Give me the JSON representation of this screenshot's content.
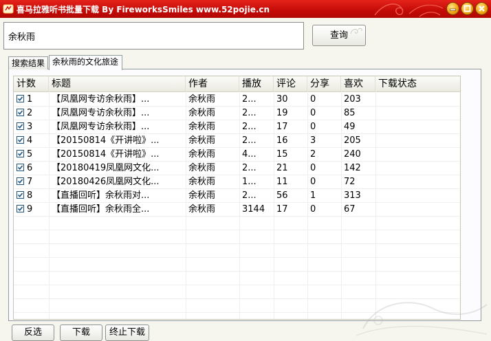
{
  "window": {
    "title": "喜马拉雅听书批量下载 By FireworksSmiles www.52pojie.cn"
  },
  "search": {
    "value": "余秋雨",
    "button_label": "查询"
  },
  "tabs": [
    {
      "label": "搜索结果",
      "active": false
    },
    {
      "label": "余秋雨的文化旅途",
      "active": true
    }
  ],
  "table": {
    "columns": [
      "计数",
      "标题",
      "作者",
      "播放",
      "评论",
      "分享",
      "喜欢",
      "下载状态"
    ],
    "rows": [
      {
        "count": "1",
        "title": "【凤凰网专访余秋雨】...",
        "author": "余秋雨",
        "plays": "2...",
        "comments": "30",
        "shares": "0",
        "likes": "203",
        "status": ""
      },
      {
        "count": "2",
        "title": "【凤凰网专访余秋雨】...",
        "author": "余秋雨",
        "plays": "2...",
        "comments": "19",
        "shares": "0",
        "likes": "85",
        "status": ""
      },
      {
        "count": "3",
        "title": "【凤凰网专访余秋雨】...",
        "author": "余秋雨",
        "plays": "2...",
        "comments": "17",
        "shares": "0",
        "likes": "49",
        "status": ""
      },
      {
        "count": "4",
        "title": "【20150814《开讲啦》...",
        "author": "余秋雨",
        "plays": "2...",
        "comments": "16",
        "shares": "3",
        "likes": "205",
        "status": ""
      },
      {
        "count": "5",
        "title": "【20150814《开讲啦》...",
        "author": "余秋雨",
        "plays": "4...",
        "comments": "15",
        "shares": "2",
        "likes": "240",
        "status": ""
      },
      {
        "count": "6",
        "title": "【20180419凤凰网文化...",
        "author": "余秋雨",
        "plays": "2...",
        "comments": "21",
        "shares": "0",
        "likes": "142",
        "status": ""
      },
      {
        "count": "7",
        "title": "【20180426凤凰网文化...",
        "author": "余秋雨",
        "plays": "1...",
        "comments": "11",
        "shares": "0",
        "likes": "72",
        "status": ""
      },
      {
        "count": "8",
        "title": "【直播回听】余秋雨对...",
        "author": "余秋雨",
        "plays": "2...",
        "comments": "56",
        "shares": "1",
        "likes": "313",
        "status": ""
      },
      {
        "count": "9",
        "title": "【直播回听】余秋雨全...",
        "author": "余秋雨",
        "plays": "3144",
        "comments": "17",
        "shares": "0",
        "likes": "67",
        "status": ""
      }
    ]
  },
  "bottom_buttons": {
    "invert_label": "反选",
    "download_label": "下载",
    "stop_label": "终止下载"
  },
  "icons": {
    "app": "app-icon",
    "minimize": "minimize-icon",
    "maximize": "maximize-icon",
    "close": "close-icon"
  },
  "colors": {
    "titlebar": "#c40b07",
    "window_button": "#f1a513",
    "checkbox_check": "#1c5180"
  }
}
